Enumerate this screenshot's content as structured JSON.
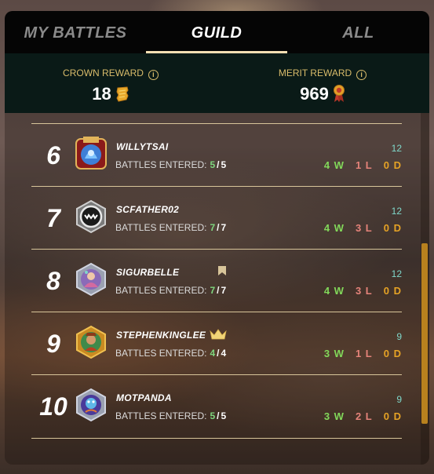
{
  "tabs": [
    {
      "label": "MY BATTLES",
      "active": false
    },
    {
      "label": "GUILD",
      "active": true
    },
    {
      "label": "ALL",
      "active": false
    }
  ],
  "rewards": {
    "crown": {
      "label": "CROWN REWARD",
      "value": "18",
      "icon": "crown-token-icon"
    },
    "merit": {
      "label": "MERIT REWARD",
      "value": "969",
      "icon": "merit-medal-icon"
    }
  },
  "battles_label": "BATTLES ENTERED:",
  "players": [
    {
      "rank": "6",
      "name": "WILLYTSAI",
      "entered": "5",
      "total_battles": "5",
      "score": "12",
      "wins": "4 W",
      "losses": "1 L",
      "draws": "0 D",
      "badge": null
    },
    {
      "rank": "7",
      "name": "SCFATHER02",
      "entered": "7",
      "total_battles": "7",
      "score": "12",
      "wins": "4 W",
      "losses": "3 L",
      "draws": "0 D",
      "badge": null
    },
    {
      "rank": "8",
      "name": "SIGURBELLE",
      "entered": "7",
      "total_battles": "7",
      "score": "12",
      "wins": "4 W",
      "losses": "3 L",
      "draws": "0 D",
      "badge": "bookmark-icon"
    },
    {
      "rank": "9",
      "name": "STEPHENKINGLEE",
      "entered": "4",
      "total_battles": "4",
      "score": "9",
      "wins": "3 W",
      "losses": "1 L",
      "draws": "0 D",
      "badge": "crown-icon"
    },
    {
      "rank": "10",
      "name": "MOTPANDA",
      "entered": "5",
      "total_battles": "5",
      "score": "9",
      "wins": "3 W",
      "losses": "2 L",
      "draws": "0 D",
      "badge": null
    }
  ],
  "colors": {
    "tab_active_underline": "#f5dfb3",
    "reward_label": "#d8bb6a",
    "wins": "#82d85a",
    "losses": "#e5837a",
    "draws": "#e6a325",
    "score": "#7fd7c9",
    "scrollbar": "#b8811e"
  }
}
